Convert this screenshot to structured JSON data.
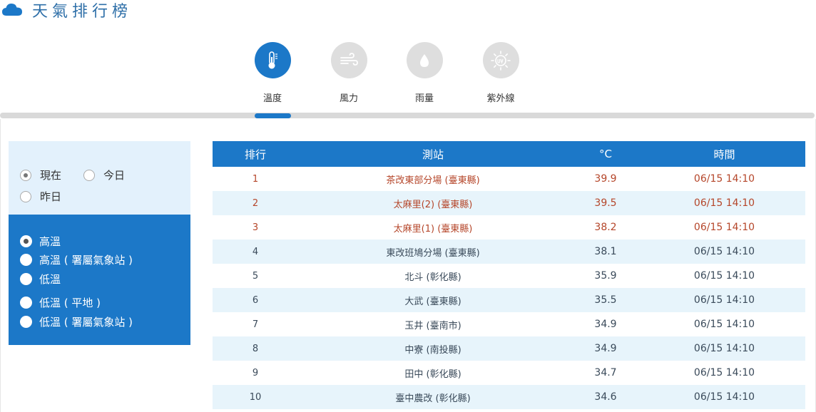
{
  "header": {
    "title": "天氣排行榜",
    "icon": "cloud-icon"
  },
  "tabs": [
    {
      "label": "溫度",
      "icon": "thermometer-icon",
      "active": true
    },
    {
      "label": "風力",
      "icon": "wind-icon",
      "active": false
    },
    {
      "label": "雨量",
      "icon": "raindrop-icon",
      "active": false
    },
    {
      "label": "紫外線",
      "icon": "uv-sun-icon",
      "active": false
    }
  ],
  "time_filter": [
    {
      "label": "現在",
      "checked": true
    },
    {
      "label": "今日",
      "checked": false
    },
    {
      "label": "昨日",
      "checked": false
    }
  ],
  "type_filter": [
    {
      "label": "高溫",
      "checked": true
    },
    {
      "label": "高溫 ( 署屬氣象站 )",
      "checked": false
    },
    {
      "label": "低溫",
      "checked": false
    },
    {
      "label": "低溫 ( 平地 )",
      "checked": false
    },
    {
      "label": "低溫 ( 署屬氣象站 )",
      "checked": false
    }
  ],
  "table": {
    "headers": {
      "rank": "排行",
      "station": "測站",
      "temp": "°C",
      "time": "時間"
    },
    "rows": [
      {
        "rank": "1",
        "station": "茶改東部分場 (臺東縣)",
        "temp": "39.9",
        "time": "06/15 14:10"
      },
      {
        "rank": "2",
        "station": "太麻里(2) (臺東縣)",
        "temp": "39.5",
        "time": "06/15 14:10"
      },
      {
        "rank": "3",
        "station": "太麻里(1) (臺東縣)",
        "temp": "38.2",
        "time": "06/15 14:10"
      },
      {
        "rank": "4",
        "station": "東改班鳩分場 (臺東縣)",
        "temp": "38.1",
        "time": "06/15 14:10"
      },
      {
        "rank": "5",
        "station": "北斗 (彰化縣)",
        "temp": "35.9",
        "time": "06/15 14:10"
      },
      {
        "rank": "6",
        "station": "大武 (臺東縣)",
        "temp": "35.5",
        "time": "06/15 14:10"
      },
      {
        "rank": "7",
        "station": "玉井 (臺南市)",
        "temp": "34.9",
        "time": "06/15 14:10"
      },
      {
        "rank": "8",
        "station": "中寮 (南投縣)",
        "temp": "34.9",
        "time": "06/15 14:10"
      },
      {
        "rank": "9",
        "station": "田中 (彰化縣)",
        "temp": "34.7",
        "time": "06/15 14:10"
      },
      {
        "rank": "10",
        "station": "臺中農改 (彰化縣)",
        "temp": "34.6",
        "time": "06/15 14:10"
      }
    ]
  },
  "colors": {
    "accent": "#1c78c8",
    "top_rank_text": "#b5462a",
    "alt_row": "#e7f4fb"
  }
}
